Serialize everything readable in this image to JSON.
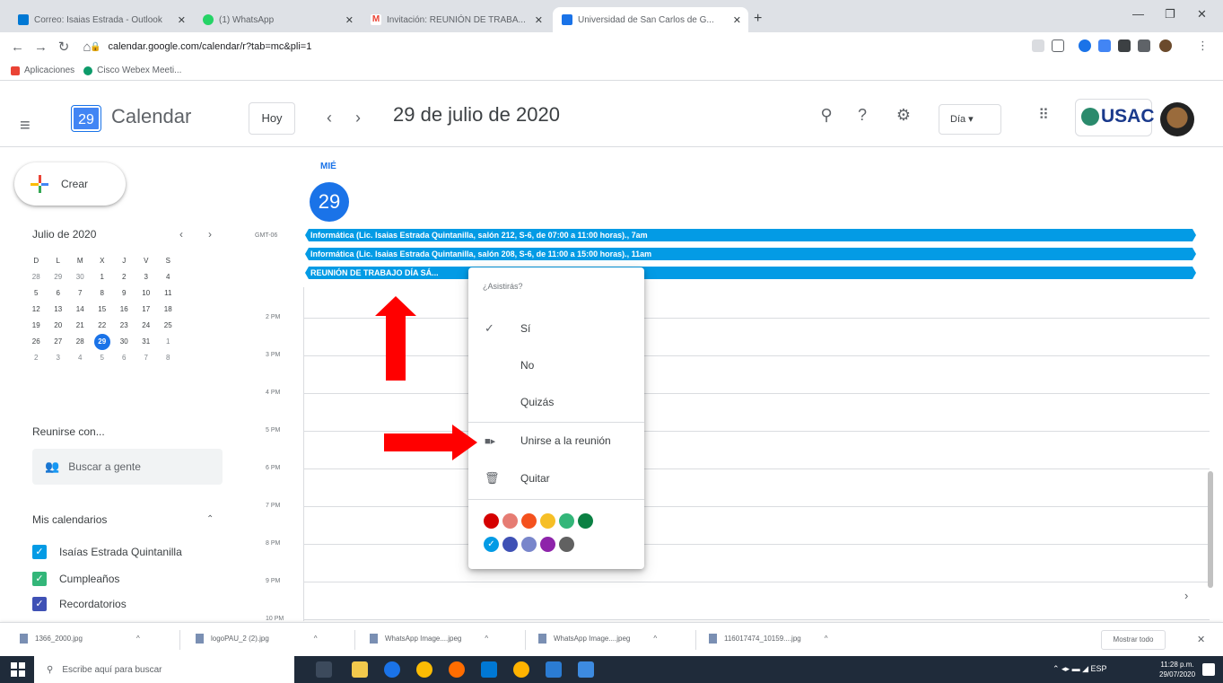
{
  "browser": {
    "tabs": [
      {
        "title": "Correo: Isaias Estrada - Outlook",
        "color": "#0078d4"
      },
      {
        "title": "(1) WhatsApp",
        "color": "#25d366"
      },
      {
        "title": "Invitación: REUNIÓN DE TRABA...",
        "color": "#ea4335"
      },
      {
        "title": "Universidad de San Carlos de G...",
        "color": "#1a73e8"
      }
    ],
    "url": "calendar.google.com/calendar/r?tab=mc&pli=1",
    "bookmarks": [
      {
        "label": "Aplicaciones"
      },
      {
        "label": "Cisco Webex Meeti..."
      }
    ]
  },
  "header": {
    "logo_day": "29",
    "app_name": "Calendar",
    "today_button": "Hoy",
    "prev": "‹",
    "next": "›",
    "date_title": "29 de julio de 2020",
    "view_select": "Día ▾",
    "org_badge": "USAC"
  },
  "sidebar": {
    "create_label": "Crear",
    "mini_calendar": {
      "title": "Julio de 2020",
      "weekdays": [
        "D",
        "L",
        "M",
        "X",
        "J",
        "V",
        "S"
      ],
      "weeks": [
        [
          "28",
          "29",
          "30",
          "1",
          "2",
          "3",
          "4"
        ],
        [
          "5",
          "6",
          "7",
          "8",
          "9",
          "10",
          "11"
        ],
        [
          "12",
          "13",
          "14",
          "15",
          "16",
          "17",
          "18"
        ],
        [
          "19",
          "20",
          "21",
          "22",
          "23",
          "24",
          "25"
        ],
        [
          "26",
          "27",
          "28",
          "29",
          "30",
          "31",
          "1"
        ],
        [
          "2",
          "3",
          "4",
          "5",
          "6",
          "7",
          "8"
        ]
      ],
      "selected_day": "29"
    },
    "meet_title": "Reunirse con...",
    "search_people": "Buscar a gente",
    "my_calendars_title": "Mis calendarios",
    "calendars": [
      {
        "label": "Isaías Estrada Quintanilla",
        "color": "#039be5"
      },
      {
        "label": "Cumpleaños",
        "color": "#33b679"
      },
      {
        "label": "Recordatorios",
        "color": "#3f51b5"
      }
    ]
  },
  "day_view": {
    "weekday": "MIÉ",
    "day_number": "29",
    "timezone": "GMT-06",
    "events": [
      {
        "title": "Informática (Lic. Isaias Estrada Quintanilla, salón 212, S-6, de 07:00 a 11:00 horas)., 7am",
        "color": "#039be5"
      },
      {
        "title": "Informática (Lic. Isaias Estrada Quintanilla, salón 208, S-6, de 11:00 a 15:00 horas)., 11am",
        "color": "#039be5"
      },
      {
        "title": "REUNIÓN DE TRABAJO DÍA SÁ...",
        "color": "#039be5"
      }
    ],
    "hours": [
      "2 PM",
      "3 PM",
      "4 PM",
      "5 PM",
      "6 PM",
      "7 PM",
      "8 PM",
      "9 PM",
      "10 PM"
    ]
  },
  "context_menu": {
    "header": "¿Asistirás?",
    "rsvp": [
      {
        "label": "Sí",
        "checked": true
      },
      {
        "label": "No",
        "checked": false
      },
      {
        "label": "Quizás",
        "checked": false
      }
    ],
    "join_meeting": "Unirse a la reunión",
    "remove": "Quitar",
    "colors_row1": [
      "#d50000",
      "#e67c73",
      "#f4511e",
      "#f6bf26",
      "#33b679",
      "#0b8043"
    ],
    "colors_row2": [
      "#039be5",
      "#3f51b5",
      "#7986cb",
      "#8e24aa",
      "#616161"
    ],
    "selected_color": "#039be5"
  },
  "downloads": {
    "items": [
      "1366_2000.jpg",
      "logoPAU_2 (2).jpg",
      "WhatsApp Image....jpeg",
      "WhatsApp Image....jpeg",
      "116017474_10159....jpg"
    ],
    "show_all": "Mostrar todo"
  },
  "taskbar": {
    "search_placeholder": "Escribe aquí para buscar",
    "tray": "ESP",
    "time": "11:28 p.m.",
    "date": "29/07/2020"
  }
}
